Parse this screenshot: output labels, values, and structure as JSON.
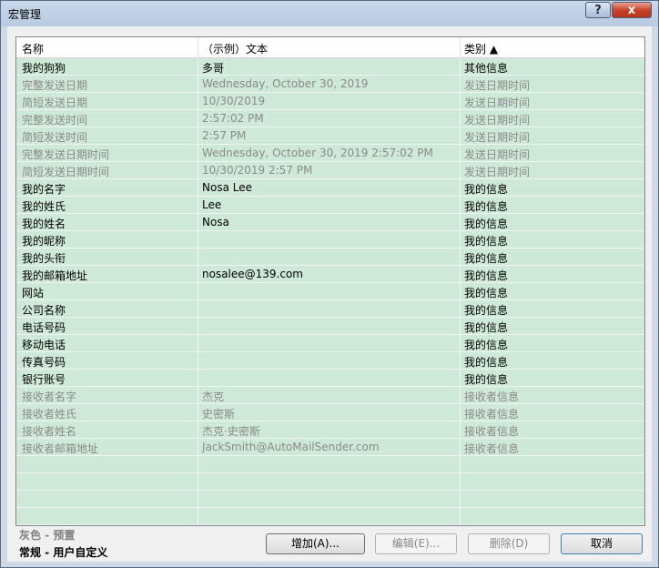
{
  "window": {
    "title": "宏管理"
  },
  "titlebar": {
    "help_label": "?",
    "close_label": "x"
  },
  "columns": [
    "名称",
    "（示例）文本",
    "类别 ▲"
  ],
  "rows": [
    {
      "name": "我的狗狗",
      "text": "多哥",
      "category": "其他信息",
      "style": "black"
    },
    {
      "name": "完整发送日期",
      "text": "Wednesday, October 30, 2019",
      "category": "发送日期时间",
      "style": "gray"
    },
    {
      "name": "简短发送日期",
      "text": "10/30/2019",
      "category": "发送日期时间",
      "style": "gray"
    },
    {
      "name": "完整发送时间",
      "text": "2:57:02 PM",
      "category": "发送日期时间",
      "style": "gray"
    },
    {
      "name": "简短发送时间",
      "text": "2:57 PM",
      "category": "发送日期时间",
      "style": "gray"
    },
    {
      "name": "完整发送日期时间",
      "text": "Wednesday, October 30, 2019 2:57:02 PM",
      "category": "发送日期时间",
      "style": "gray"
    },
    {
      "name": "简短发送日期时间",
      "text": "10/30/2019 2:57 PM",
      "category": "发送日期时间",
      "style": "gray"
    },
    {
      "name": "我的名字",
      "text": "Nosa Lee",
      "category": "我的信息",
      "style": "black"
    },
    {
      "name": "我的姓氏",
      "text": "Lee",
      "category": "我的信息",
      "style": "black"
    },
    {
      "name": "我的姓名",
      "text": "Nosa",
      "category": "我的信息",
      "style": "black"
    },
    {
      "name": "我的昵称",
      "text": "",
      "category": "我的信息",
      "style": "black"
    },
    {
      "name": "我的头衔",
      "text": "",
      "category": "我的信息",
      "style": "black"
    },
    {
      "name": "我的邮箱地址",
      "text": "nosalee@139.com",
      "category": "我的信息",
      "style": "black"
    },
    {
      "name": "网站",
      "text": "",
      "category": "我的信息",
      "style": "black"
    },
    {
      "name": "公司名称",
      "text": "",
      "category": "我的信息",
      "style": "black"
    },
    {
      "name": "电话号码",
      "text": "",
      "category": "我的信息",
      "style": "black"
    },
    {
      "name": "移动电话",
      "text": "",
      "category": "我的信息",
      "style": "black"
    },
    {
      "name": "传真号码",
      "text": "",
      "category": "我的信息",
      "style": "black"
    },
    {
      "name": "银行账号",
      "text": "",
      "category": "我的信息",
      "style": "black"
    },
    {
      "name": "接收者名字",
      "text": "杰克",
      "category": "接收者信息",
      "style": "gray"
    },
    {
      "name": "接收者姓氏",
      "text": "史密斯",
      "category": "接收者信息",
      "style": "gray"
    },
    {
      "name": "接收者姓名",
      "text": "杰克·史密斯",
      "category": "接收者信息",
      "style": "gray"
    },
    {
      "name": "接收者邮箱地址",
      "text": "JackSmith@AutoMailSender.com",
      "category": "接收者信息",
      "style": "gray"
    }
  ],
  "legend": {
    "gray": "灰色 - 预置",
    "normal": "常规 - 用户自定义"
  },
  "buttons": {
    "add": "增加(A)...",
    "edit": "编辑(E)...",
    "delete": "删除(D)",
    "cancel": "取消"
  },
  "colors": {
    "list_bg": "#cfe9d8",
    "preset_text": "#8a8a8a",
    "user_text": "#000000"
  }
}
